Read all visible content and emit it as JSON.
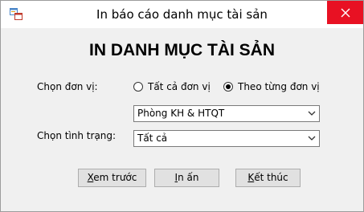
{
  "window": {
    "title": "In báo cáo danh mục tài sản"
  },
  "form": {
    "heading": "IN DANH MỤC TÀI SẢN",
    "unit_label": "Chọn đơn vị:",
    "radio_all": "Tất cả đơn vị",
    "radio_each": "Theo từng đơn vị",
    "selected_radio": "radio_each",
    "unit_value": "Phòng KH & HTQT",
    "status_label": "Chọn tình trạng:",
    "status_value": "Tất cả"
  },
  "buttons": {
    "preview_first": "X",
    "preview_rest": "em trước",
    "print_first": "I",
    "print_rest": "n ấn",
    "close_first": "K",
    "close_rest": "ết thúc"
  },
  "colors": {
    "close_button": "#e81123",
    "window_bg": "#f0f0f0"
  }
}
